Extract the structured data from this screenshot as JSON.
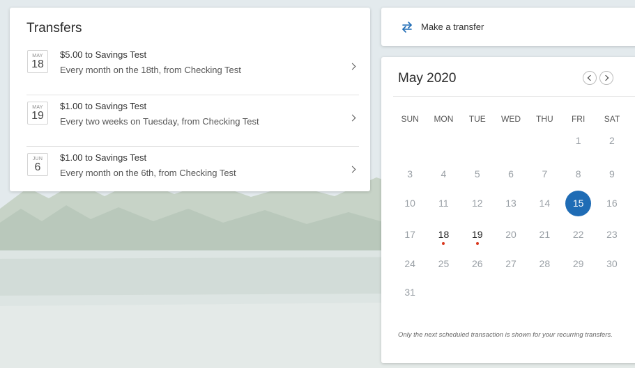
{
  "colors": {
    "accent": "#1f6cb5",
    "event_dot": "#d9381e"
  },
  "transfers": {
    "title": "Transfers",
    "items": [
      {
        "month": "MAY",
        "day": "18",
        "amount_text": "$5.00 to Savings Test",
        "description": "Every month on the 18th, from Checking Test"
      },
      {
        "month": "MAY",
        "day": "19",
        "amount_text": "$1.00 to Savings Test",
        "description": "Every two weeks on Tuesday, from Checking Test"
      },
      {
        "month": "JUN",
        "day": "6",
        "amount_text": "$1.00 to Savings Test",
        "description": "Every month on the 6th, from Checking Test"
      }
    ]
  },
  "make_transfer": {
    "label": "Make a transfer",
    "icon": "swap-arrows-icon"
  },
  "calendar": {
    "title": "May 2020",
    "prev_icon": "chevron-left-icon",
    "next_icon": "chevron-right-icon",
    "weekdays": [
      "SUN",
      "MON",
      "TUE",
      "WED",
      "THU",
      "FRI",
      "SAT"
    ],
    "weeks": [
      [
        "",
        "",
        "",
        "",
        "",
        "1",
        "2"
      ],
      [
        "3",
        "4",
        "5",
        "6",
        "7",
        "8",
        "9"
      ],
      [
        "10",
        "11",
        "12",
        "13",
        "14",
        "15",
        "16"
      ],
      [
        "17",
        "18",
        "19",
        "20",
        "21",
        "22",
        "23"
      ],
      [
        "24",
        "25",
        "26",
        "27",
        "28",
        "29",
        "30"
      ],
      [
        "31",
        "",
        "",
        "",
        "",
        "",
        ""
      ]
    ],
    "selected_day": "15",
    "event_days": [
      "18",
      "19"
    ],
    "note": "Only the next scheduled transaction is shown for your recurring transfers."
  }
}
